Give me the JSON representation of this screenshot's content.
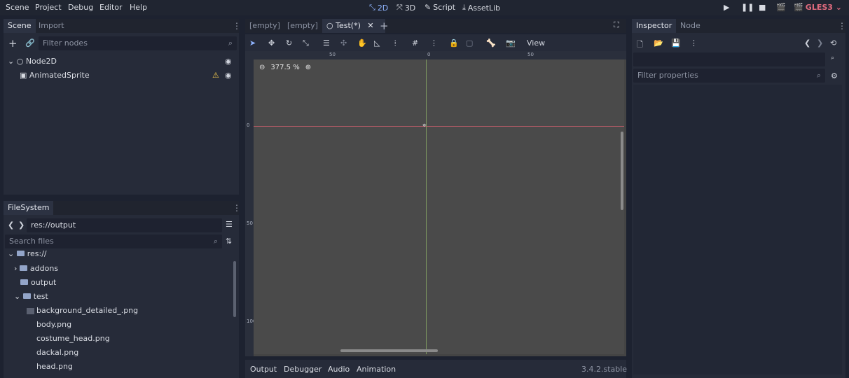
{
  "menubar": {
    "items": [
      "Scene",
      "Project",
      "Debug",
      "Editor",
      "Help"
    ],
    "workspaces": [
      {
        "label": "2D",
        "icon": "2d-icon",
        "active": true
      },
      {
        "label": "3D",
        "icon": "3d-icon",
        "active": false
      },
      {
        "label": "Script",
        "icon": "script-icon",
        "active": false
      },
      {
        "label": "AssetLib",
        "icon": "assetlib-icon",
        "active": false
      }
    ],
    "renderer": "GLES3"
  },
  "scene_dock": {
    "tabs": [
      "Scene",
      "Import"
    ],
    "filter_placeholder": "Filter nodes",
    "tree": [
      {
        "label": "Node2D",
        "icon": "node2d-icon"
      },
      {
        "label": "AnimatedSprite",
        "icon": "animatedsprite-icon",
        "warning": true
      }
    ]
  },
  "filesystem_dock": {
    "title": "FileSystem",
    "path": "res://output",
    "search_placeholder": "Search files",
    "tree": [
      {
        "label": "res://",
        "type": "root"
      },
      {
        "label": "addons",
        "type": "folder"
      },
      {
        "label": "output",
        "type": "folder"
      },
      {
        "label": "test",
        "type": "folder"
      },
      {
        "label": "background_detailed_.png",
        "type": "file"
      },
      {
        "label": "body.png",
        "type": "file"
      },
      {
        "label": "costume_head.png",
        "type": "file"
      },
      {
        "label": "dackal.png",
        "type": "file"
      },
      {
        "label": "head.png",
        "type": "file"
      }
    ]
  },
  "editor": {
    "scene_tabs": [
      "[empty]",
      "[empty]",
      "Test(*)"
    ],
    "toolbar": {
      "view_label": "View"
    },
    "zoom": "377.5 %",
    "ruler": {
      "h": [
        "50",
        "0",
        "50"
      ],
      "v": [
        "0",
        "50",
        "100"
      ]
    }
  },
  "bottom_panel": {
    "tabs": [
      "Output",
      "Debugger",
      "Audio",
      "Animation"
    ],
    "version": "3.4.2.stable"
  },
  "inspector": {
    "tabs": [
      "Inspector",
      "Node"
    ],
    "filter_placeholder": "Filter properties"
  },
  "colors": {
    "bg": "#1d2230",
    "panel": "#262b39",
    "accent": "#8fb4ff",
    "renderer": "#e06b7e",
    "canvas": "#4a4a4a"
  }
}
